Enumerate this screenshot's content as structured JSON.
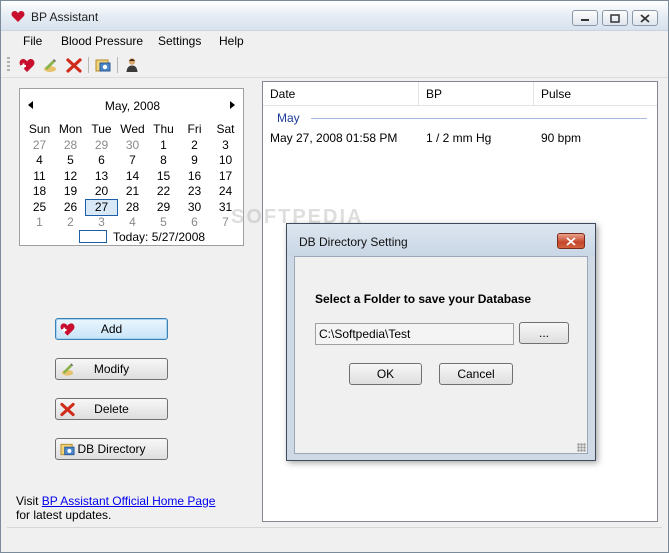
{
  "window": {
    "title": "BP Assistant",
    "accent": "#c8102e"
  },
  "menu": [
    "File",
    "Blood Pressure",
    "Settings",
    "Help"
  ],
  "toolbar": {
    "icons": [
      "heart-add-icon",
      "modify-icon",
      "delete-icon",
      "db-directory-icon",
      "user-icon"
    ]
  },
  "calendar": {
    "month_label": "May, 2008",
    "days_of_week": [
      "Sun",
      "Mon",
      "Tue",
      "Wed",
      "Thu",
      "Fri",
      "Sat"
    ],
    "weeks": [
      [
        "27",
        "28",
        "29",
        "30",
        "1",
        "2",
        "3"
      ],
      [
        "4",
        "5",
        "6",
        "7",
        "8",
        "9",
        "10"
      ],
      [
        "11",
        "12",
        "13",
        "14",
        "15",
        "16",
        "17"
      ],
      [
        "18",
        "19",
        "20",
        "21",
        "22",
        "23",
        "24"
      ],
      [
        "25",
        "26",
        "27",
        "28",
        "29",
        "30",
        "31"
      ],
      [
        "1",
        "2",
        "3",
        "4",
        "5",
        "6",
        "7"
      ]
    ],
    "selected_day": "27",
    "today_label": "Today: 5/27/2008"
  },
  "actions": {
    "add": "Add",
    "modify": "Modify",
    "delete": "Delete",
    "db_directory": "DB Directory"
  },
  "footer": {
    "visit_prefix": "Visit ",
    "link_text": "BP Assistant Official Home Page",
    "suffix": "for latest updates."
  },
  "list": {
    "columns": [
      "Date",
      "BP",
      "Pulse"
    ],
    "group": "May",
    "rows": [
      {
        "date": "May 27, 2008 01:58 PM",
        "bp": "1 / 2 mm Hg",
        "pulse": "90 bpm"
      }
    ]
  },
  "watermark": "SOFTPEDIA",
  "dialog": {
    "title": "DB Directory Setting",
    "label": "Select a Folder to save your Database",
    "path_value": "C:\\Softpedia\\Test",
    "browse_label": "...",
    "ok_label": "OK",
    "cancel_label": "Cancel"
  }
}
